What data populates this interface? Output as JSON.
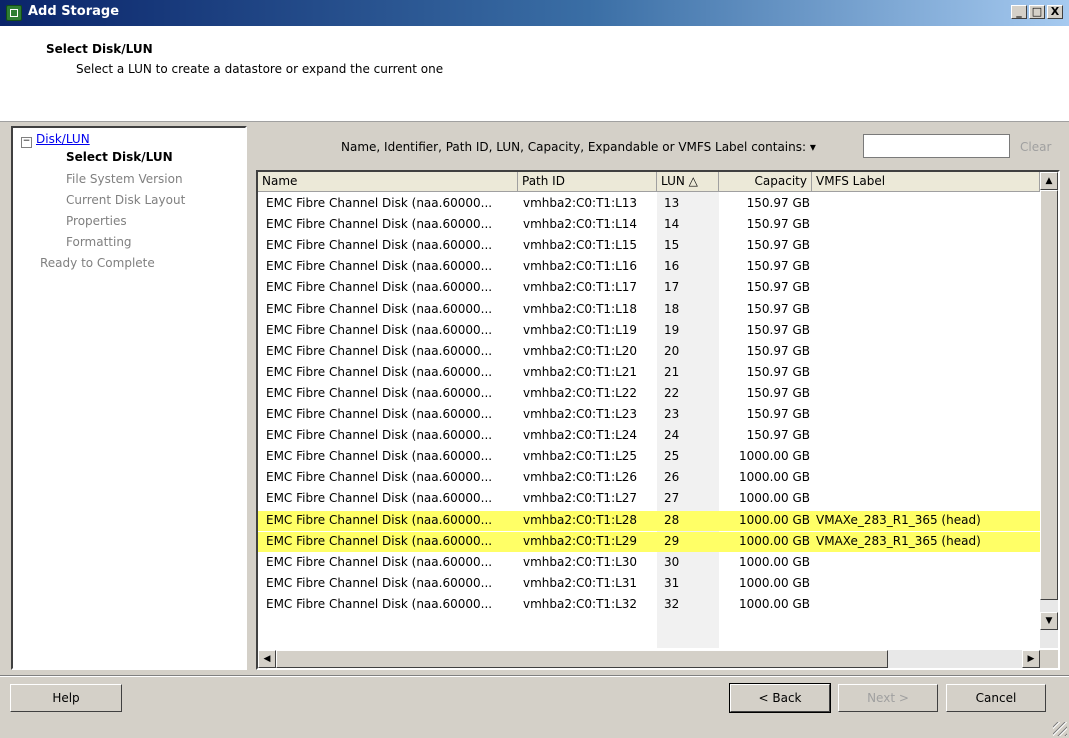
{
  "window": {
    "title": "Add Storage",
    "minimize": "_",
    "maximize": "□",
    "close": "X"
  },
  "header": {
    "title": "Select Disk/LUN",
    "subtitle": "Select a LUN to create a datastore or expand the current one"
  },
  "nav": {
    "root": "Disk/LUN",
    "expander": "−",
    "items": [
      "Select Disk/LUN",
      "File System Version",
      "Current Disk Layout",
      "Properties",
      "Formatting",
      "Ready to Complete"
    ],
    "current": "Select Disk/LUN"
  },
  "filter": {
    "label": "Name, Identifier, Path ID, LUN, Capacity, Expandable or VMFS Label contains: ▾",
    "value": "",
    "clear": "Clear"
  },
  "table": {
    "headers": [
      "Name",
      "Path ID",
      "LUN △",
      "Capacity",
      "VMFS Label"
    ],
    "rows": [
      {
        "name": "EMC Fibre Channel Disk (naa.60000...",
        "path": "vmhba2:C0:T1:L13",
        "lun": "13",
        "cap": "150.97 GB",
        "label": ""
      },
      {
        "name": "EMC Fibre Channel Disk (naa.60000...",
        "path": "vmhba2:C0:T1:L14",
        "lun": "14",
        "cap": "150.97 GB",
        "label": ""
      },
      {
        "name": "EMC Fibre Channel Disk (naa.60000...",
        "path": "vmhba2:C0:T1:L15",
        "lun": "15",
        "cap": "150.97 GB",
        "label": ""
      },
      {
        "name": "EMC Fibre Channel Disk (naa.60000...",
        "path": "vmhba2:C0:T1:L16",
        "lun": "16",
        "cap": "150.97 GB",
        "label": ""
      },
      {
        "name": "EMC Fibre Channel Disk (naa.60000...",
        "path": "vmhba2:C0:T1:L17",
        "lun": "17",
        "cap": "150.97 GB",
        "label": ""
      },
      {
        "name": "EMC Fibre Channel Disk (naa.60000...",
        "path": "vmhba2:C0:T1:L18",
        "lun": "18",
        "cap": "150.97 GB",
        "label": ""
      },
      {
        "name": "EMC Fibre Channel Disk (naa.60000...",
        "path": "vmhba2:C0:T1:L19",
        "lun": "19",
        "cap": "150.97 GB",
        "label": ""
      },
      {
        "name": "EMC Fibre Channel Disk (naa.60000...",
        "path": "vmhba2:C0:T1:L20",
        "lun": "20",
        "cap": "150.97 GB",
        "label": ""
      },
      {
        "name": "EMC Fibre Channel Disk (naa.60000...",
        "path": "vmhba2:C0:T1:L21",
        "lun": "21",
        "cap": "150.97 GB",
        "label": ""
      },
      {
        "name": "EMC Fibre Channel Disk (naa.60000...",
        "path": "vmhba2:C0:T1:L22",
        "lun": "22",
        "cap": "150.97 GB",
        "label": ""
      },
      {
        "name": "EMC Fibre Channel Disk (naa.60000...",
        "path": "vmhba2:C0:T1:L23",
        "lun": "23",
        "cap": "150.97 GB",
        "label": ""
      },
      {
        "name": "EMC Fibre Channel Disk (naa.60000...",
        "path": "vmhba2:C0:T1:L24",
        "lun": "24",
        "cap": "150.97 GB",
        "label": ""
      },
      {
        "name": "EMC Fibre Channel Disk (naa.60000...",
        "path": "vmhba2:C0:T1:L25",
        "lun": "25",
        "cap": "1000.00 GB",
        "label": ""
      },
      {
        "name": "EMC Fibre Channel Disk (naa.60000...",
        "path": "vmhba2:C0:T1:L26",
        "lun": "26",
        "cap": "1000.00 GB",
        "label": ""
      },
      {
        "name": "EMC Fibre Channel Disk (naa.60000...",
        "path": "vmhba2:C0:T1:L27",
        "lun": "27",
        "cap": "1000.00 GB",
        "label": ""
      },
      {
        "name": "EMC Fibre Channel Disk (naa.60000...",
        "path": "vmhba2:C0:T1:L28",
        "lun": "28",
        "cap": "1000.00 GB",
        "label": "VMAXe_283_R1_365 (head)",
        "highlight": true
      },
      {
        "name": "EMC Fibre Channel Disk (naa.60000...",
        "path": "vmhba2:C0:T1:L29",
        "lun": "29",
        "cap": "1000.00 GB",
        "label": "VMAXe_283_R1_365 (head)",
        "highlight": true
      },
      {
        "name": "EMC Fibre Channel Disk (naa.60000...",
        "path": "vmhba2:C0:T1:L30",
        "lun": "30",
        "cap": "1000.00 GB",
        "label": ""
      },
      {
        "name": "EMC Fibre Channel Disk (naa.60000...",
        "path": "vmhba2:C0:T1:L31",
        "lun": "31",
        "cap": "1000.00 GB",
        "label": ""
      },
      {
        "name": "EMC Fibre Channel Disk (naa.60000...",
        "path": "vmhba2:C0:T1:L32",
        "lun": "32",
        "cap": "1000.00 GB",
        "label": ""
      }
    ]
  },
  "buttons": {
    "help": "Help",
    "back": "< Back",
    "next": "Next >",
    "cancel": "Cancel"
  },
  "colors": {
    "highlight": "#ffff66",
    "titlebar": "#0a246a",
    "link": "#0000ee"
  }
}
